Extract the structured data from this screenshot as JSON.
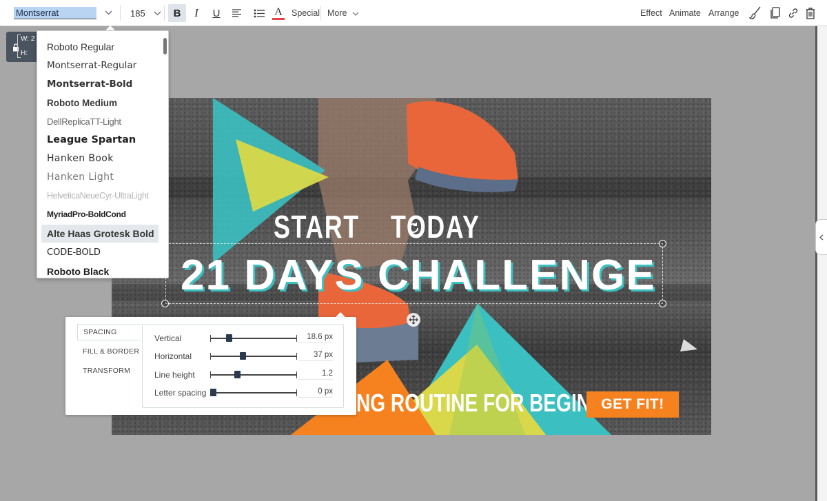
{
  "toolbar": {
    "font_name": "Montserrat",
    "font_size": "185",
    "bold": "B",
    "italic": "I",
    "underline": "U",
    "text_color_letter": "A",
    "special_label": "Special",
    "more_label": "More",
    "effect_label": "Effect",
    "animate_label": "Animate",
    "arrange_label": "Arrange",
    "chevron": "⌵"
  },
  "dimensions_box": {
    "w_label": "W:",
    "w_value": "2",
    "h_label": "H:"
  },
  "font_dropdown": {
    "items": [
      {
        "label": "Roboto Regular"
      },
      {
        "label": "Montserrat-Regular"
      },
      {
        "label": "Montserrat-Bold"
      },
      {
        "label": "Roboto Medium"
      },
      {
        "label": "DellReplicaTT-Light"
      },
      {
        "label": "League Spartan"
      },
      {
        "label": "Hanken Book"
      },
      {
        "label": "Hanken Light"
      },
      {
        "label": "HelveticaNeueCyr-UltraLight"
      },
      {
        "label": "MyriadPro-BoldCond"
      },
      {
        "label": "Alte Haas Grotesk Bold"
      },
      {
        "label": "CODE-BOLD"
      },
      {
        "label": "Roboto Black"
      }
    ],
    "active_item": "Alte Haas Grotesk Bold"
  },
  "canvas": {
    "line1_start": "START",
    "line1_today": "TODAY",
    "main_title": "21 DAYS CHALLENGE",
    "subtitle": "NG ROUTINE FOR BEGINNERS",
    "cta": "GET FIT!",
    "colors": {
      "teal": "#3bbfc0",
      "yellow": "#d9d84a",
      "orange": "#f5821f",
      "cta": "#f5821f"
    }
  },
  "spacing_panel": {
    "tabs": [
      "SPACING",
      "FILL & BORDER",
      "TRANSFORM"
    ],
    "active_tab": "SPACING",
    "rows": [
      {
        "label": "Vertical",
        "value": "18.6 px",
        "level": 0.2
      },
      {
        "label": "Horizontal",
        "value": "37 px",
        "level": 0.37
      },
      {
        "label": "Line height",
        "value": "1.2",
        "level": 0.3
      },
      {
        "label": "Letter spacing",
        "value": "0 px",
        "level": 0.0
      }
    ]
  },
  "icons": [
    "chevron-down-icon",
    "align-icon",
    "list-icon",
    "text-color-icon",
    "brush-icon",
    "copy-icon",
    "link-icon",
    "trash-icon",
    "lock-icon",
    "rotate-icon",
    "move-icon",
    "collapse-chevron-icon"
  ]
}
